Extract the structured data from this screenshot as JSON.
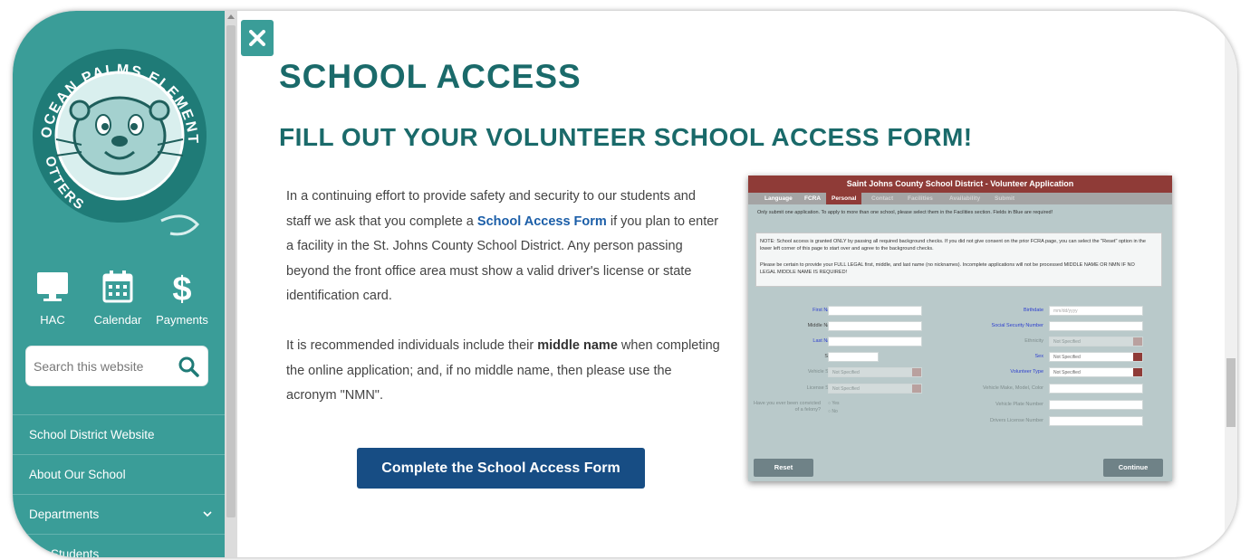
{
  "colors": {
    "sidebar": "#3a9d98",
    "heading": "#1a6a6a",
    "link": "#1b5ea8",
    "cta": "#174d84",
    "form_title": "#8f3b37"
  },
  "logo": {
    "arc_text": "OCEAN PALMS ELEMENTARY",
    "lower_text": "OTTERS",
    "icon": "otter-mascot-icon"
  },
  "quick_links": [
    {
      "label": "HAC",
      "icon": "monitor-icon"
    },
    {
      "label": "Calendar",
      "icon": "calendar-icon"
    },
    {
      "label": "Payments",
      "icon": "dollar-icon"
    }
  ],
  "search": {
    "placeholder": "Search this website",
    "icon": "search-icon"
  },
  "nav": [
    {
      "label": "School District Website"
    },
    {
      "label": "About Our School"
    },
    {
      "label": "Departments",
      "icon": "chevron-down-icon"
    },
    {
      "label": "For Students"
    }
  ],
  "close": {
    "icon": "close-icon"
  },
  "main": {
    "title": "SCHOOL ACCESS",
    "subtitle": "FILL OUT YOUR VOLUNTEER SCHOOL ACCESS FORM!",
    "p1_before": "In a continuing effort to provide safety and security to our students and staff we ask that you complete a ",
    "p1_link": "School Access Form",
    "p1_after": " if you plan to enter a facility in the St. Johns County School District. Any person passing beyond the front office area must show a valid driver's license or state identification card.",
    "p2_before": "It is recommended individuals include their ",
    "p2_bold": "middle name",
    "p2_after": " when completing the online application; and, if no middle name, then please use the acronym \"NMN\".",
    "cta": "Complete the School Access Form"
  },
  "form_shot": {
    "title": "Saint Johns County School District - Volunteer Application",
    "tabs": [
      "Language",
      "FCRA",
      "Personal",
      "Contact",
      "Facilities",
      "Availability",
      "Submit"
    ],
    "note1": "Only submit one application. To apply to more than one school, please select them in the Facilities section. Fields in Blue are required!",
    "note2": "NOTE: School access is granted ONLY by passing all required background checks. If you did not give consent on the prior FCRA page, you can select the \"Reset\" option in the lower left corner of this page to start over and agree to the background checks.",
    "note3": "Please be certain to provide your FULL LEGAL first, middle, and last name (no nicknames). Incomplete applications will not be processed MIDDLE NAME OR NMN IF NO LEGAL MIDDLE NAME IS REQUIRED!",
    "left_labels": [
      "First Name",
      "Middle Name",
      "Last Name",
      "Suffix",
      "Vehicle State",
      "License State",
      "Have you ever been convicted of a felony?"
    ],
    "right_labels": [
      "Birthdate",
      "Social Security Number",
      "Ethnicity",
      "Sex",
      "Volunteer Type",
      "Vehicle Make, Model, Color",
      "Vehicle Plate Number",
      "Drivers License Number"
    ],
    "not_specified": "Not Specified",
    "birthdate_placeholder": "mm/dd/yyyy",
    "radio_yes": "Yes",
    "radio_no": "No",
    "reset": "Reset",
    "continue": "Continue"
  }
}
